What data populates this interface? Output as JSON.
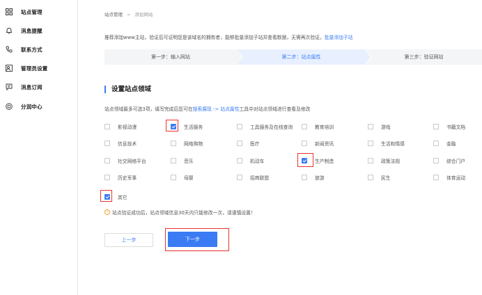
{
  "sidebar": {
    "items": [
      {
        "label": "站点管理",
        "icon": "site-icon"
      },
      {
        "label": "消息提醒",
        "icon": "bell-icon"
      },
      {
        "label": "联系方式",
        "icon": "phone-icon"
      },
      {
        "label": "管理员设置",
        "icon": "user-admin-icon"
      },
      {
        "label": "消息订阅",
        "icon": "message-icon"
      },
      {
        "label": "分润中心",
        "icon": "coin-icon"
      }
    ]
  },
  "breadcrumb": {
    "parent": "站点管理",
    "sep": ">",
    "current": "添加网站"
  },
  "notice": {
    "text": "推荐添加www主站，验证后可证明您是该域名的拥有者，能够批量添加子站并查看数据，无需再次验证。",
    "link": "批量添加子站"
  },
  "steps": [
    {
      "label": "第一步：输入网站",
      "active": false
    },
    {
      "label": "第二步：站点属性",
      "active": true
    },
    {
      "label": "第三步：验证网站",
      "active": false
    }
  ],
  "section": {
    "title": "设置站点领域"
  },
  "hint": {
    "prefix": "站点领域最多可选3项，填写完成后您可在",
    "link1": "搜索展现",
    "arrow": " -> ",
    "link2": "站点属性",
    "suffix": "工具中对站点领域进行查看及修改"
  },
  "categories": [
    {
      "label": "影视动漫",
      "checked": false
    },
    {
      "label": "生活服务",
      "checked": true
    },
    {
      "label": "工具服务及在线查询",
      "checked": false
    },
    {
      "label": "教育培训",
      "checked": false
    },
    {
      "label": "游戏",
      "checked": false
    },
    {
      "label": "书籍文档",
      "checked": false
    },
    {
      "label": "信息技术",
      "checked": false
    },
    {
      "label": "网络购物",
      "checked": false
    },
    {
      "label": "医疗",
      "checked": false
    },
    {
      "label": "新闻资讯",
      "checked": false
    },
    {
      "label": "生活和情感",
      "checked": false
    },
    {
      "label": "金融",
      "checked": false
    },
    {
      "label": "社交网络平台",
      "checked": false
    },
    {
      "label": "音乐",
      "checked": false
    },
    {
      "label": "机动车",
      "checked": false
    },
    {
      "label": "生产制造",
      "checked": true
    },
    {
      "label": "政策法规",
      "checked": false
    },
    {
      "label": "综合门户",
      "checked": false
    },
    {
      "label": "历史军事",
      "checked": false
    },
    {
      "label": "母婴",
      "checked": false
    },
    {
      "label": "招商联盟",
      "checked": false
    },
    {
      "label": "旅游",
      "checked": false
    },
    {
      "label": "民生",
      "checked": false
    },
    {
      "label": "体育运动",
      "checked": false
    },
    {
      "label": "其它",
      "checked": true
    }
  ],
  "warning": {
    "text": "站点验证成功后，站点领域信息30天内只能修改一次，请谨慎设置！"
  },
  "buttons": {
    "prev": "上一步",
    "next": "下一步"
  },
  "colors": {
    "accent": "#3b7bf4",
    "highlight": "#e8322c",
    "warning": "#f0a030"
  }
}
